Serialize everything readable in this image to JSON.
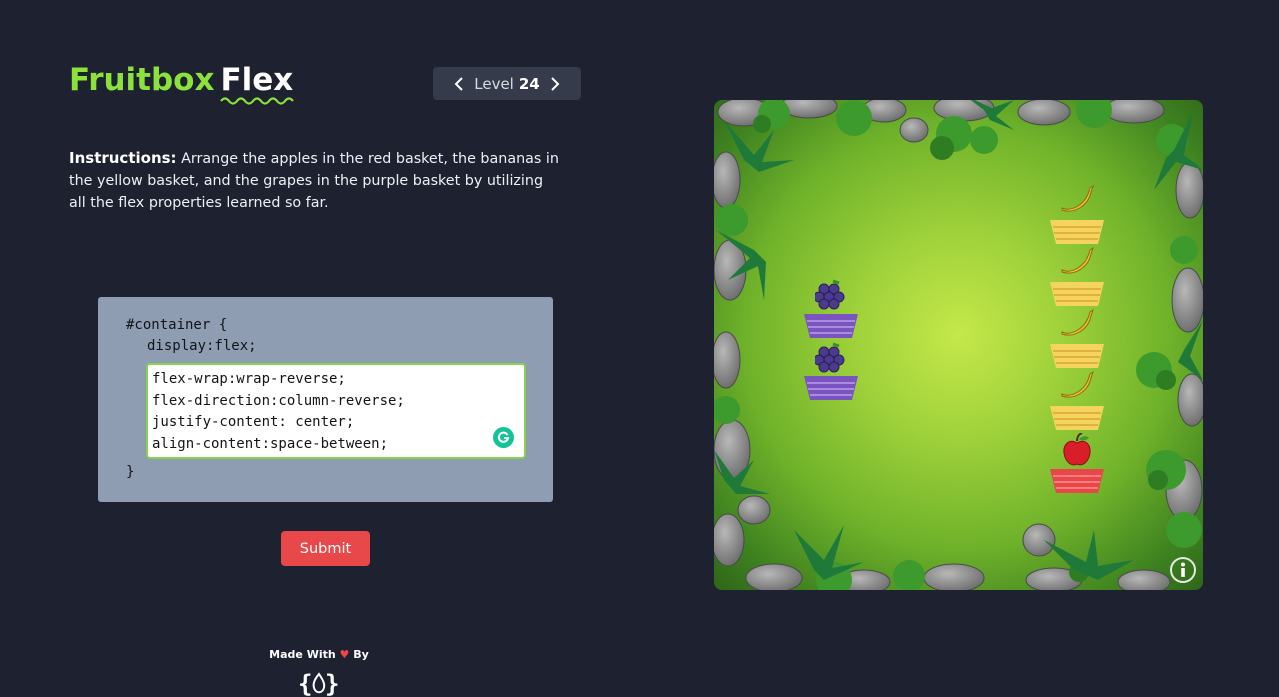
{
  "app": {
    "title_part1": "Fruitbox",
    "title_part2": "Flex"
  },
  "level_nav": {
    "label": "Level",
    "number": "24",
    "prev_icon": "chevron-left-icon",
    "next_icon": "chevron-right-icon"
  },
  "instructions": {
    "heading": "Instructions:",
    "text": " Arrange the apples in the red basket, the bananas in the yellow basket, and the grapes in the purple basket by utilizing all the flex properties learned so far."
  },
  "code": {
    "selector_line": "#container {",
    "fixed_line": "display:flex;",
    "input_lines": [
      "flex-wrap:wrap-reverse;",
      "flex-direction:column-reverse;",
      "justify-content: center;",
      "align-content:space-between;"
    ],
    "closing_line": "}"
  },
  "submit": {
    "label": "Submit"
  },
  "footer": {
    "made_with": "Made With",
    "by": "By"
  },
  "colors": {
    "accent_green": "#8be23a",
    "submit_red": "#e9484a",
    "background": "#1d2130",
    "code_panel": "#8f9db3",
    "basket_red": "#e8474a",
    "basket_yellow": "#f4d35e",
    "basket_purple": "#7a55c0"
  },
  "board": {
    "fruits": [
      {
        "type": "grapes",
        "icon": "grapes-icon"
      },
      {
        "type": "grapes",
        "icon": "grapes-icon"
      },
      {
        "type": "banana",
        "icon": "banana-icon"
      },
      {
        "type": "banana",
        "icon": "banana-icon"
      },
      {
        "type": "banana",
        "icon": "banana-icon"
      },
      {
        "type": "banana",
        "icon": "banana-icon"
      },
      {
        "type": "apple",
        "icon": "apple-icon"
      }
    ],
    "baskets": [
      "purple",
      "purple",
      "yellow",
      "yellow",
      "yellow",
      "yellow",
      "red"
    ],
    "info_icon": "info-icon"
  }
}
